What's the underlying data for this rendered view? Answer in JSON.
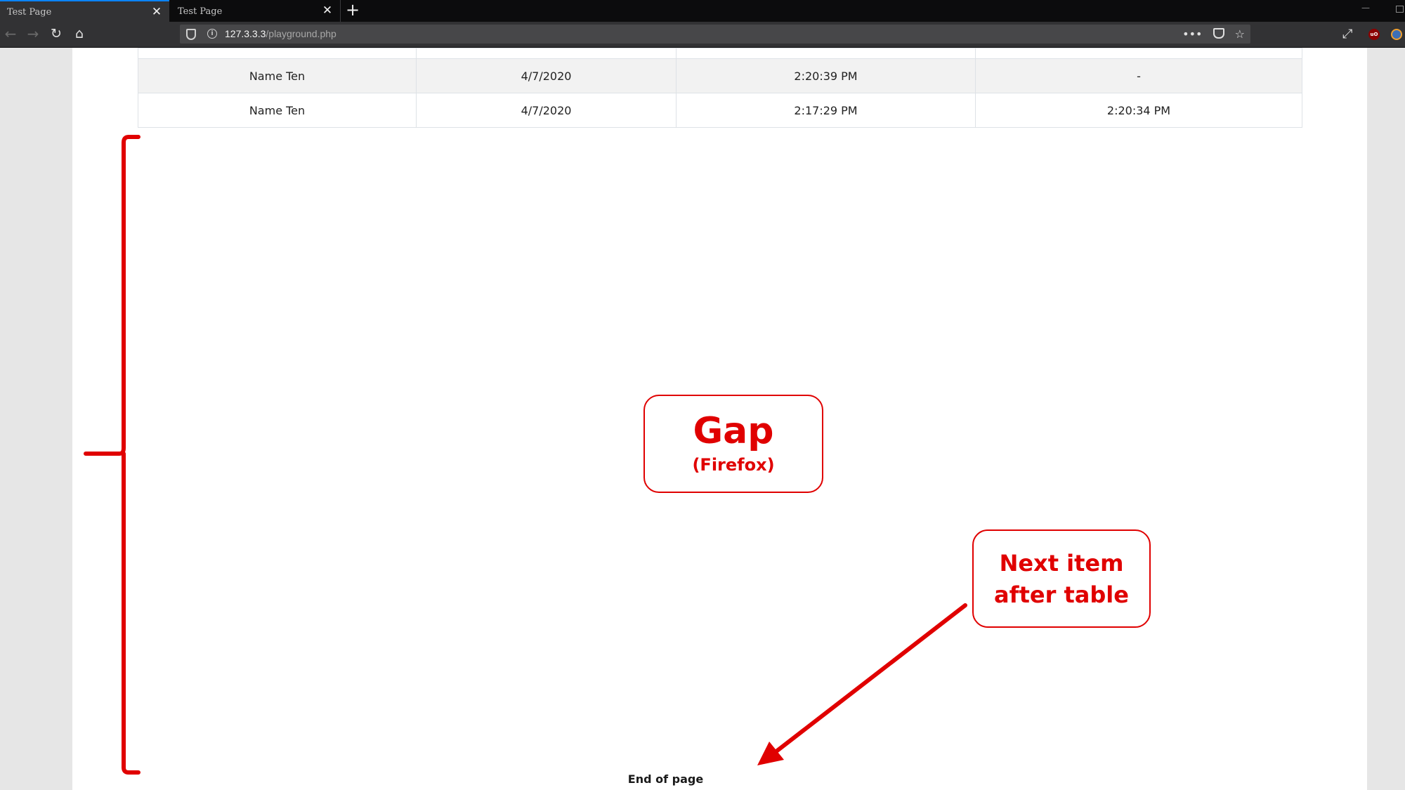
{
  "browser": {
    "tabs": [
      {
        "title": "Test Page",
        "active": true
      },
      {
        "title": "Test Page",
        "active": false
      }
    ],
    "new_tab_symbol": "+",
    "close_symbol": "✕",
    "url_host": "127.3.3.3",
    "url_path": "/playground.php",
    "page_actions_symbol": "•••",
    "bookmark_symbol": "☆",
    "expand_symbol": "⤢",
    "ublock_label": "uO",
    "window_minimize_symbol": "—",
    "icons": [
      "back-arrow-icon",
      "forward-arrow-icon",
      "reload-icon",
      "home-icon",
      "shield-icon",
      "info-icon",
      "pocket-icon",
      "star-icon",
      "expand-icon",
      "ublock-icon",
      "extension-icon"
    ]
  },
  "table": {
    "rows": [
      {
        "cells": [
          "",
          "",
          "",
          ""
        ],
        "cut_off": true
      },
      {
        "cells": [
          "Name Ten",
          "4/7/2020",
          "2:20:39 PM",
          "-"
        ],
        "striped": true
      },
      {
        "cells": [
          "Name Ten",
          "4/7/2020",
          "2:17:29 PM",
          "2:20:34 PM"
        ],
        "striped": false
      }
    ]
  },
  "page": {
    "end_text": "End of page"
  },
  "annotations": {
    "gap_title": "Gap",
    "gap_subtitle": "(Firefox)",
    "next_item_line1": "Next item",
    "next_item_line2": "after table",
    "color": "#e00000"
  },
  "colors": {
    "tab_active_accent": "#0a84ff",
    "chrome_dark": "#0c0c0d",
    "toolbar": "#323234",
    "urlbar": "#474749",
    "page_side": "#e6e6e6",
    "table_border": "#dee2e6",
    "row_stripe": "#f2f2f2"
  }
}
